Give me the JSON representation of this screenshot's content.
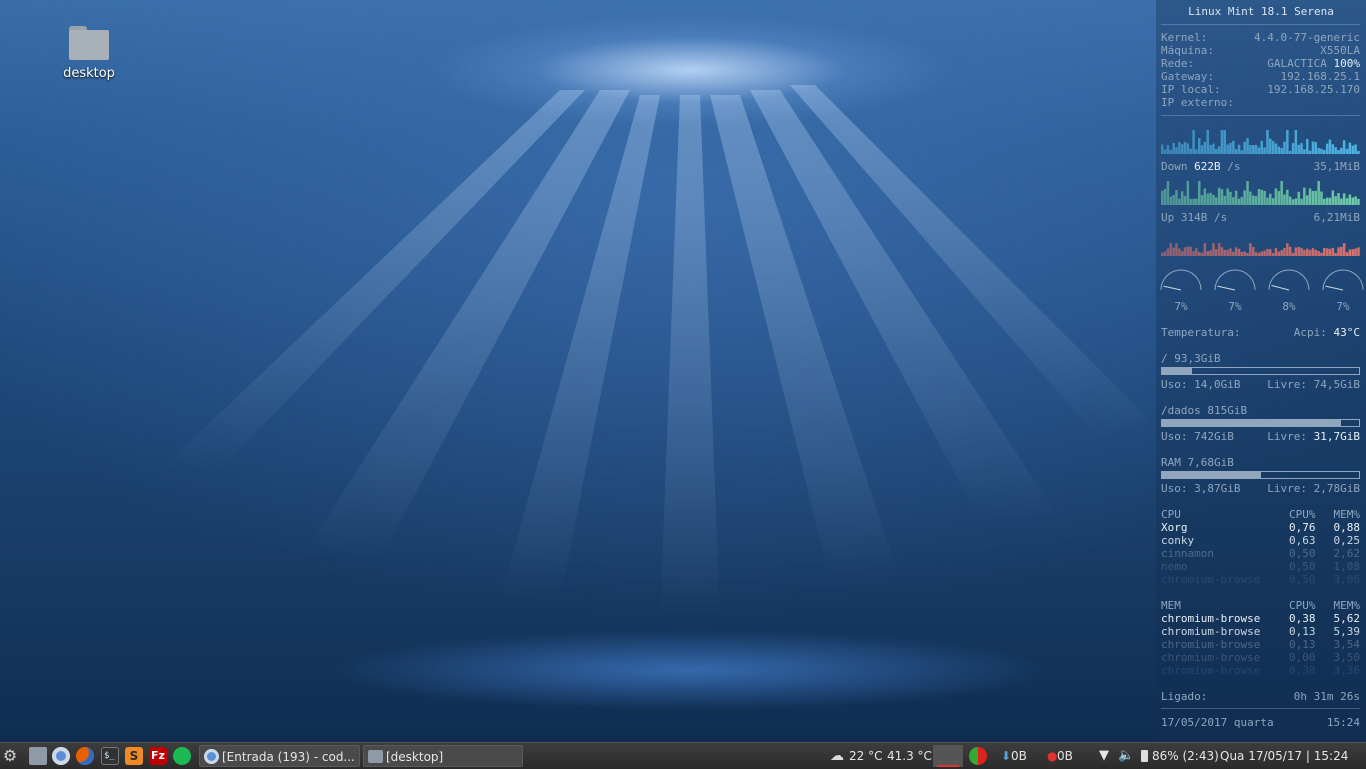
{
  "desktop": {
    "icon_label": "desktop"
  },
  "conky": {
    "title": "Linux Mint 18.1 Serena",
    "sysinfo": [
      {
        "label": "Kernel:",
        "value": "4.4.0-77-generic",
        "extra": ""
      },
      {
        "label": "Máquina:",
        "value": "X550LA",
        "extra": ""
      },
      {
        "label": "Rede:",
        "value": "GALACTICA",
        "extra": "100%"
      },
      {
        "label": "Gateway:",
        "value": "192.168.25.1",
        "extra": ""
      },
      {
        "label": "IP local:",
        "value": "192.168.25.170",
        "extra": ""
      },
      {
        "label": "IP externo:",
        "value": "",
        "extra": ""
      }
    ],
    "down": {
      "label": "Down",
      "rate": "622B",
      "unit": "/s",
      "total": "35,1MiB"
    },
    "up": {
      "label": "Up",
      "rate": "314B",
      "unit": "/s",
      "total": "6,21MiB"
    },
    "cores": [
      {
        "label": "7%",
        "value": 0.07
      },
      {
        "label": "7%",
        "value": 0.07
      },
      {
        "label": "8%",
        "value": 0.08
      },
      {
        "label": "7%",
        "value": 0.07
      }
    ],
    "temperature": {
      "label": "Temperatura:",
      "sensor": "Acpi:",
      "value": "43°C"
    },
    "disks": [
      {
        "title": "/ 93,3GiB",
        "fill": 0.15,
        "uso_label": "Uso:",
        "uso": "14,0GiB",
        "livre_label": "Livre:",
        "livre": "74,5GiB"
      },
      {
        "title": "/dados 815GiB",
        "fill": 0.91,
        "uso_label": "Uso:",
        "uso": "742GiB",
        "livre_label": "Livre:",
        "livre": "31,7GiB"
      }
    ],
    "ram": {
      "title": "RAM  7,68GiB",
      "fill": 0.5,
      "uso_label": "Uso:",
      "uso": "3,87GiB",
      "livre_label": "Livre:",
      "livre": "2,78GiB"
    },
    "cpu_table": {
      "header": {
        "name": "CPU",
        "cpu": "CPU%",
        "mem": "MEM%"
      },
      "rows": [
        {
          "name": "Xorg",
          "cpu": "0,76",
          "mem": "0,88"
        },
        {
          "name": "conky",
          "cpu": "0,63",
          "mem": "0,25"
        },
        {
          "name": "cinnamon",
          "cpu": "0,50",
          "mem": "2,62"
        },
        {
          "name": "nemo",
          "cpu": "0,50",
          "mem": "1,08"
        },
        {
          "name": "chromium-browse",
          "cpu": "0,50",
          "mem": "3,06"
        }
      ]
    },
    "mem_table": {
      "header": {
        "name": "MEM",
        "cpu": "CPU%",
        "mem": "MEM%"
      },
      "rows": [
        {
          "name": "chromium-browse",
          "cpu": "0,38",
          "mem": "5,62"
        },
        {
          "name": "chromium-browse",
          "cpu": "0,13",
          "mem": "5,39"
        },
        {
          "name": "chromium-browse",
          "cpu": "0,13",
          "mem": "3,54"
        },
        {
          "name": "chromium-browse",
          "cpu": "0,00",
          "mem": "3,50"
        },
        {
          "name": "chromium-browse",
          "cpu": "0,38",
          "mem": "3,36"
        }
      ]
    },
    "uptime": {
      "label": "Ligado:",
      "value": "0h 31m 26s"
    },
    "datetime": {
      "date": "17/05/2017 quarta",
      "time": "15:24"
    }
  },
  "taskbar": {
    "launchers": [
      {
        "name": "menu-icon",
        "color": "#bdbdbd"
      },
      {
        "name": "files-icon",
        "color": "#8e9aa5"
      },
      {
        "name": "chromium-icon",
        "color": "#5b8fd6"
      },
      {
        "name": "firefox-icon",
        "color": "#e66000"
      },
      {
        "name": "terminal-icon",
        "color": "#2e3436"
      },
      {
        "name": "sublime-icon",
        "color": "#f08a24"
      },
      {
        "name": "filezilla-icon",
        "color": "#bf0000"
      },
      {
        "name": "spotify-icon",
        "color": "#1db954"
      }
    ],
    "windows": [
      {
        "label": "[Entrada (193) - cod...",
        "icon": "chromium-icon"
      },
      {
        "label": "[desktop]",
        "icon": "folder-icon"
      }
    ],
    "weather": "22 °C",
    "cpu_temp": "41.3 °C",
    "net_down": "0B",
    "net_up": "0B",
    "battery": "86% (2:43)",
    "clock": "Qua 17/05/17 | 15:24"
  }
}
